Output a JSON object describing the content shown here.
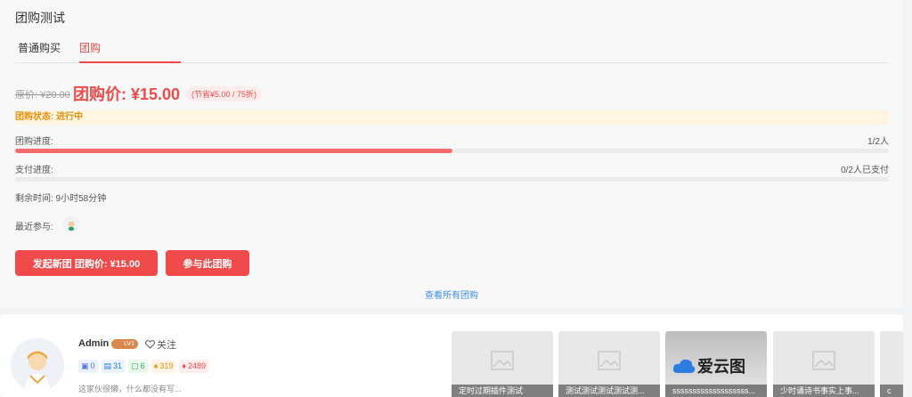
{
  "header": {
    "title": "团购测试"
  },
  "tabs": [
    {
      "label": "普通购买"
    },
    {
      "label": "团购"
    }
  ],
  "price": {
    "original": "原价: ¥20.00",
    "group": "团购价: ¥15.00",
    "saving": "(节省¥5.00 / 75折)"
  },
  "status": {
    "label": "团购状态: 进行中"
  },
  "progress": {
    "group_label": "团购进度:",
    "group_value": "1/2人",
    "group_fraction": 0.5,
    "pay_label": "支付进度:",
    "pay_value": "0/2人已支付",
    "pay_fraction": 0
  },
  "remaining": "剩余时间: 9小时58分钟",
  "recent_label": "最近参与:",
  "buttons": {
    "start": "发起新团 团购价: ¥15.00",
    "join": "参与此团购"
  },
  "view_all": "查看所有团购",
  "author": {
    "name": "Admin",
    "level": "LV1",
    "follow": "关注",
    "stats": [
      "0",
      "31",
      "6",
      "319",
      "2489"
    ],
    "bio": "这家伙很懒，什么都没有写..."
  },
  "posts": [
    {
      "caption": "定时过期插件测试"
    },
    {
      "caption": "测试测试测试测试测..."
    },
    {
      "caption": "sssssssssssssssssss...",
      "logo_text": "爱云图"
    },
    {
      "caption": "少时诵诗书事实上事..."
    },
    {
      "caption": "c"
    }
  ],
  "colors": {
    "accent": "#f14a4a",
    "link": "#3b8cf0",
    "status": "#e8900e"
  }
}
